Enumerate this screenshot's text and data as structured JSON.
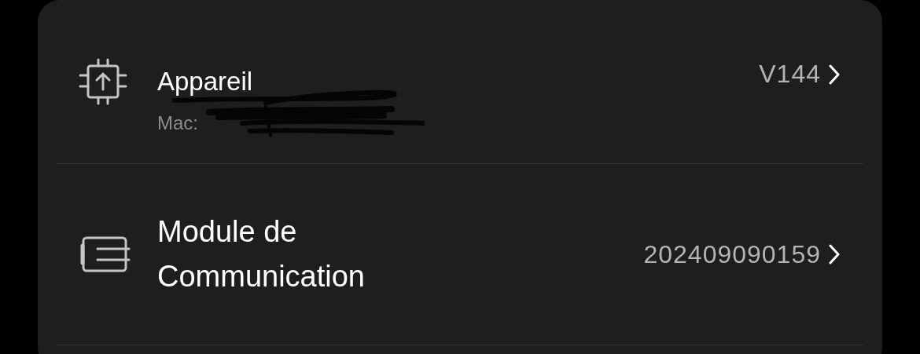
{
  "rows": [
    {
      "kind": "device",
      "title": "Appareil",
      "subtitle": "Mac:",
      "value": "V144"
    },
    {
      "kind": "module",
      "title": "Module de Communication",
      "value": "202409090159"
    }
  ]
}
